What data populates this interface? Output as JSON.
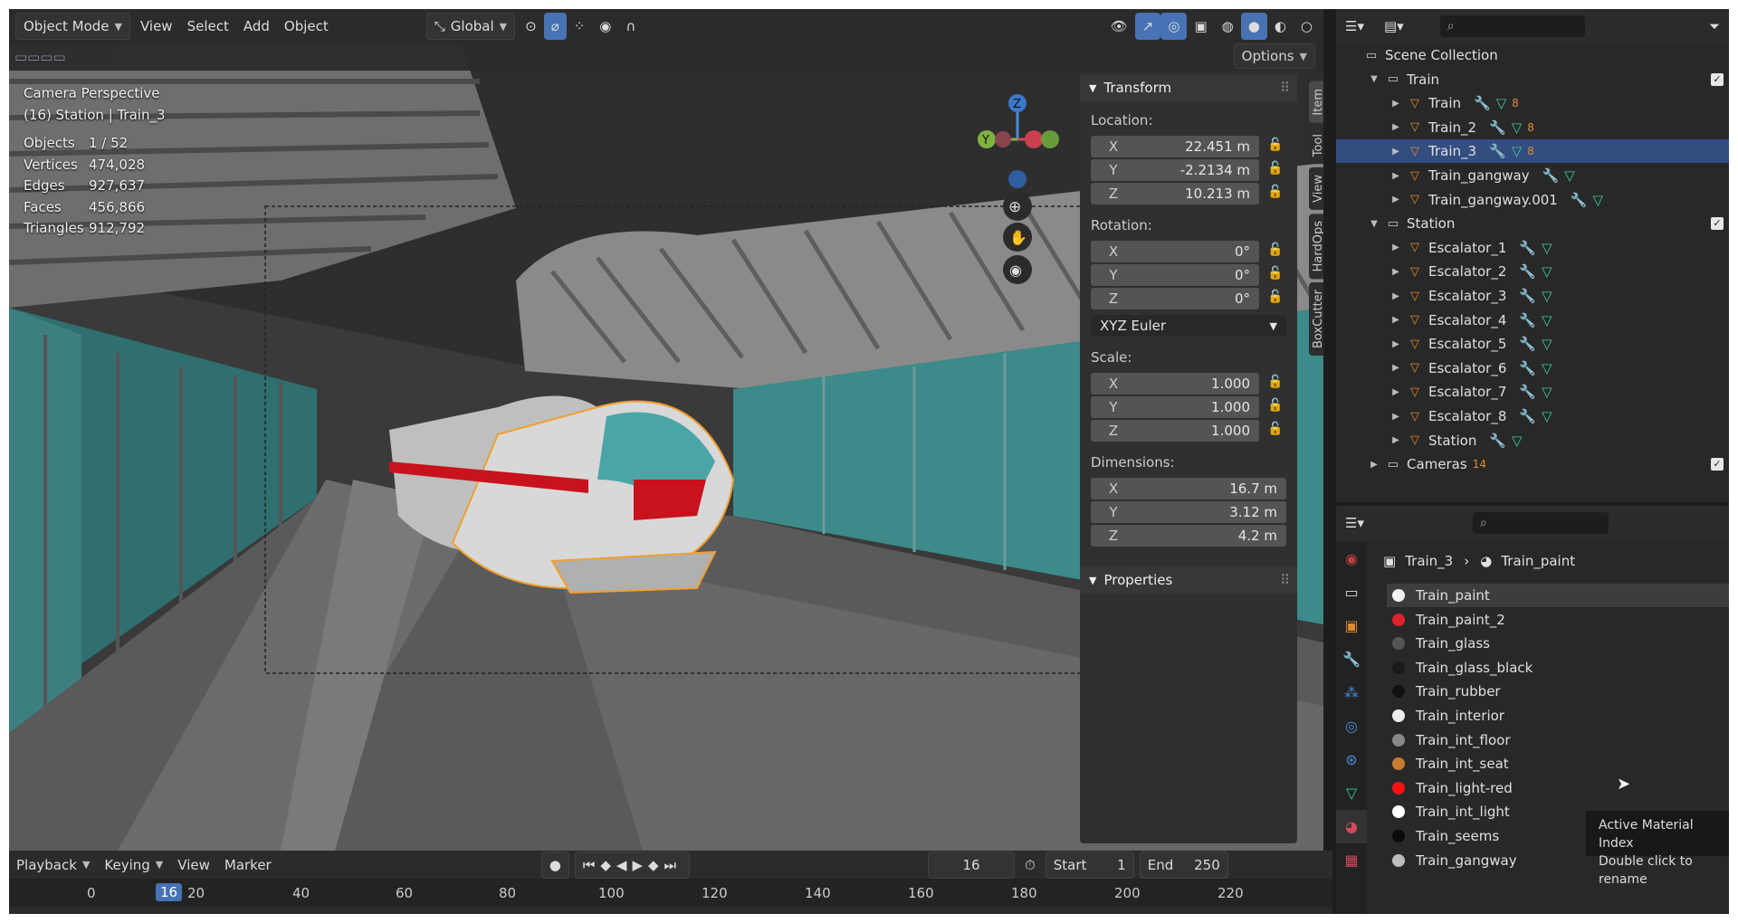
{
  "header": {
    "mode": "Object Mode",
    "menus": [
      "View",
      "Select",
      "Add",
      "Object"
    ],
    "orientation": "Global",
    "options": "Options"
  },
  "viewport": {
    "title": "Camera Perspective",
    "subtitle": "(16) Station | Train_3",
    "stats": [
      {
        "k": "Objects",
        "v": "1 / 52"
      },
      {
        "k": "Vertices",
        "v": "474,028"
      },
      {
        "k": "Edges",
        "v": "927,637"
      },
      {
        "k": "Faces",
        "v": "456,866"
      },
      {
        "k": "Triangles",
        "v": "912,792"
      }
    ],
    "gizmo": {
      "z": "Z",
      "y": "Y"
    }
  },
  "npanel": {
    "transform_title": "Transform",
    "location_label": "Location:",
    "location": [
      {
        "ax": "X",
        "v": "22.451 m"
      },
      {
        "ax": "Y",
        "v": "-2.2134 m"
      },
      {
        "ax": "Z",
        "v": "10.213 m"
      }
    ],
    "rotation_label": "Rotation:",
    "rotation": [
      {
        "ax": "X",
        "v": "0°"
      },
      {
        "ax": "Y",
        "v": "0°"
      },
      {
        "ax": "Z",
        "v": "0°"
      }
    ],
    "rotation_mode": "XYZ Euler",
    "scale_label": "Scale:",
    "scale": [
      {
        "ax": "X",
        "v": "1.000"
      },
      {
        "ax": "Y",
        "v": "1.000"
      },
      {
        "ax": "Z",
        "v": "1.000"
      }
    ],
    "dimensions_label": "Dimensions:",
    "dimensions": [
      {
        "ax": "X",
        "v": "16.7 m"
      },
      {
        "ax": "Y",
        "v": "3.12 m"
      },
      {
        "ax": "Z",
        "v": "4.2 m"
      }
    ],
    "properties_title": "Properties",
    "tabs": [
      "Item",
      "Tool",
      "View",
      "HardOps",
      "BoxCutter"
    ]
  },
  "timeline": {
    "menus": [
      "Playback",
      "Keying",
      "View",
      "Marker"
    ],
    "current_frame": "16",
    "start_label": "Start",
    "start": "1",
    "end_label": "End",
    "end": "250",
    "ruler": [
      "0",
      "20",
      "40",
      "60",
      "80",
      "100",
      "120",
      "140",
      "160",
      "180",
      "200",
      "220"
    ],
    "playhead": "16"
  },
  "outliner": {
    "rows": [
      {
        "label": "Scene Collection",
        "level": 0,
        "type": "scene"
      },
      {
        "label": "Train",
        "level": 1,
        "type": "collection",
        "expanded": true,
        "checked": true
      },
      {
        "label": "Train",
        "level": 2,
        "type": "mesh",
        "badge": "8"
      },
      {
        "label": "Train_2",
        "level": 2,
        "type": "mesh",
        "badge": "8"
      },
      {
        "label": "Train_3",
        "level": 2,
        "type": "mesh",
        "badge": "8",
        "selected": true
      },
      {
        "label": "Train_gangway",
        "level": 2,
        "type": "mesh"
      },
      {
        "label": "Train_gangway.001",
        "level": 2,
        "type": "mesh"
      },
      {
        "label": "Station",
        "level": 1,
        "type": "collection",
        "expanded": true,
        "checked": true
      },
      {
        "label": "Escalator_1",
        "level": 2,
        "type": "mesh"
      },
      {
        "label": "Escalator_2",
        "level": 2,
        "type": "mesh"
      },
      {
        "label": "Escalator_3",
        "level": 2,
        "type": "mesh"
      },
      {
        "label": "Escalator_4",
        "level": 2,
        "type": "mesh"
      },
      {
        "label": "Escalator_5",
        "level": 2,
        "type": "mesh"
      },
      {
        "label": "Escalator_6",
        "level": 2,
        "type": "mesh"
      },
      {
        "label": "Escalator_7",
        "level": 2,
        "type": "mesh"
      },
      {
        "label": "Escalator_8",
        "level": 2,
        "type": "mesh"
      },
      {
        "label": "Station",
        "level": 2,
        "type": "mesh"
      },
      {
        "label": "Cameras",
        "level": 1,
        "type": "collection",
        "badge": "14",
        "checked": true
      }
    ]
  },
  "properties": {
    "breadcrumb_object": "Train_3",
    "breadcrumb_material": "Train_paint",
    "materials": [
      {
        "name": "Train_paint",
        "color": "#f2f2f2",
        "selected": true
      },
      {
        "name": "Train_paint_2",
        "color": "#e0202a"
      },
      {
        "name": "Train_glass",
        "color": "#555555"
      },
      {
        "name": "Train_glass_black",
        "color": "#1a1a1a"
      },
      {
        "name": "Train_rubber",
        "color": "#111111"
      },
      {
        "name": "Train_interior",
        "color": "#eeeeee"
      },
      {
        "name": "Train_int_floor",
        "color": "#888888"
      },
      {
        "name": "Train_int_seat",
        "color": "#c87a2e"
      },
      {
        "name": "Train_light-red",
        "color": "#ff1010"
      },
      {
        "name": "Train_int_light",
        "color": "#ffffff"
      },
      {
        "name": "Train_seems",
        "color": "#0a0a0a"
      },
      {
        "name": "Train_gangway",
        "color": "#bdbdbd"
      }
    ]
  },
  "tooltip": {
    "line1": "Active Material Index",
    "line2": "Double click to rename"
  },
  "colors": {
    "accent": "#4772b3",
    "selection": "#334d80",
    "outline": "#f0a030",
    "teal": "#3a8a8a"
  }
}
